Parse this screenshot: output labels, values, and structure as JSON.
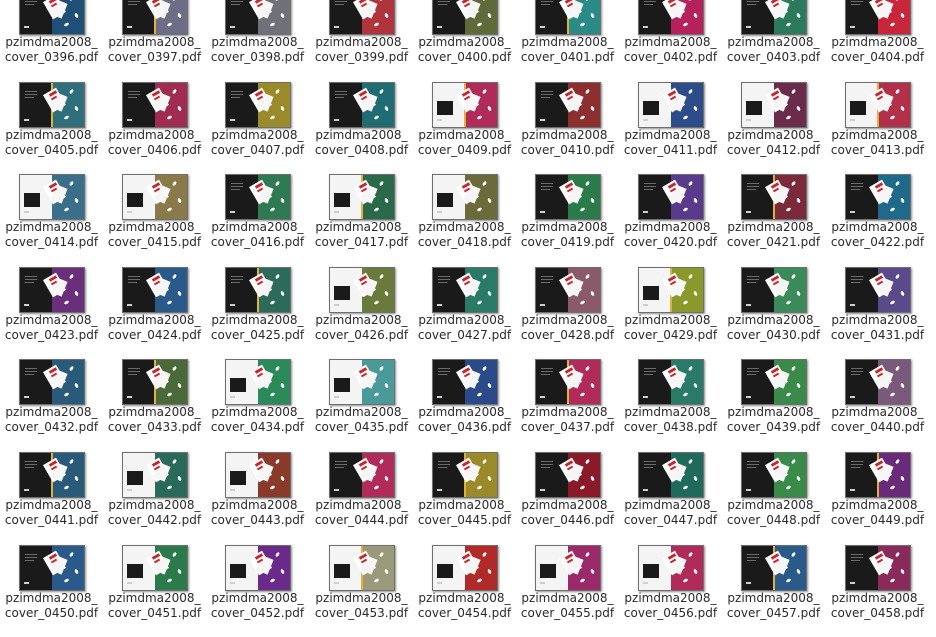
{
  "files": [
    {
      "name": "pzimdma2008_cover_0396.pdf",
      "line1": "pzimdma2008_",
      "line2": "cover_0396.pdf",
      "color": "#1f4f77",
      "variant": "dark"
    },
    {
      "name": "pzimdma2008_cover_0397.pdf",
      "line1": "pzimdma2008_",
      "line2": "cover_0397.pdf",
      "color": "#6b6e86",
      "variant": "dark"
    },
    {
      "name": "pzimdma2008_cover_0398.pdf",
      "line1": "pzimdma2008_",
      "line2": "cover_0398.pdf",
      "color": "#6f7078",
      "variant": "dark"
    },
    {
      "name": "pzimdma2008_cover_0399.pdf",
      "line1": "pzimdma2008_",
      "line2": "cover_0399.pdf",
      "color": "#b0343e",
      "variant": "dark"
    },
    {
      "name": "pzimdma2008_cover_0400.pdf",
      "line1": "pzimdma2008_",
      "line2": "cover_0400.pdf",
      "color": "#5d6a3a",
      "variant": "dark"
    },
    {
      "name": "pzimdma2008_cover_0401.pdf",
      "line1": "pzimdma2008_",
      "line2": "cover_0401.pdf",
      "color": "#2a8b86",
      "variant": "dark"
    },
    {
      "name": "pzimdma2008_cover_0402.pdf",
      "line1": "pzimdma2008_",
      "line2": "cover_0402.pdf",
      "color": "#b5225a",
      "variant": "dark"
    },
    {
      "name": "pzimdma2008_cover_0403.pdf",
      "line1": "pzimdma2008_",
      "line2": "cover_0403.pdf",
      "color": "#2c7a5c",
      "variant": "dark"
    },
    {
      "name": "pzimdma2008_cover_0404.pdf",
      "line1": "pzimdma2008_",
      "line2": "cover_0404.pdf",
      "color": "#c8263b",
      "variant": "dark"
    },
    {
      "name": "pzimdma2008_cover_0405.pdf",
      "line1": "pzimdma2008_",
      "line2": "cover_0405.pdf",
      "color": "#2f6f7b",
      "variant": "dark"
    },
    {
      "name": "pzimdma2008_cover_0406.pdf",
      "line1": "pzimdma2008_",
      "line2": "cover_0406.pdf",
      "color": "#a02c52",
      "variant": "dark"
    },
    {
      "name": "pzimdma2008_cover_0407.pdf",
      "line1": "pzimdma2008_",
      "line2": "cover_0407.pdf",
      "color": "#9b8a2a",
      "variant": "dark"
    },
    {
      "name": "pzimdma2008_cover_0408.pdf",
      "line1": "pzimdma2008_",
      "line2": "cover_0408.pdf",
      "color": "#1f6c72",
      "variant": "dark"
    },
    {
      "name": "pzimdma2008_cover_0409.pdf",
      "line1": "pzimdma2008_",
      "line2": "cover_0409.pdf",
      "color": "#b02a5a",
      "variant": "white"
    },
    {
      "name": "pzimdma2008_cover_0410.pdf",
      "line1": "pzimdma2008_",
      "line2": "cover_0410.pdf",
      "color": "#8e2f2f",
      "variant": "dark"
    },
    {
      "name": "pzimdma2008_cover_0411.pdf",
      "line1": "pzimdma2008_",
      "line2": "cover_0411.pdf",
      "color": "#2c4d8a",
      "variant": "white"
    },
    {
      "name": "pzimdma2008_cover_0412.pdf",
      "line1": "pzimdma2008_",
      "line2": "cover_0412.pdf",
      "color": "#6a2c4a",
      "variant": "white"
    },
    {
      "name": "pzimdma2008_cover_0413.pdf",
      "line1": "pzimdma2008_",
      "line2": "cover_0413.pdf",
      "color": "#b2304a",
      "variant": "white"
    },
    {
      "name": "pzimdma2008_cover_0414.pdf",
      "line1": "pzimdma2008_",
      "line2": "cover_0414.pdf",
      "color": "#3a6f89",
      "variant": "white"
    },
    {
      "name": "pzimdma2008_cover_0415.pdf",
      "line1": "pzimdma2008_",
      "line2": "cover_0415.pdf",
      "color": "#8a7a4a",
      "variant": "white"
    },
    {
      "name": "pzimdma2008_cover_0416.pdf",
      "line1": "pzimdma2008_",
      "line2": "cover_0416.pdf",
      "color": "#2f7a52",
      "variant": "dark"
    },
    {
      "name": "pzimdma2008_cover_0417.pdf",
      "line1": "pzimdma2008_",
      "line2": "cover_0417.pdf",
      "color": "#2a6a4a",
      "variant": "white"
    },
    {
      "name": "pzimdma2008_cover_0418.pdf",
      "line1": "pzimdma2008_",
      "line2": "cover_0418.pdf",
      "color": "#6a6a3a",
      "variant": "white"
    },
    {
      "name": "pzimdma2008_cover_0419.pdf",
      "line1": "pzimdma2008_",
      "line2": "cover_0419.pdf",
      "color": "#2a7a4a",
      "variant": "dark"
    },
    {
      "name": "pzimdma2008_cover_0420.pdf",
      "line1": "pzimdma2008_",
      "line2": "cover_0420.pdf",
      "color": "#5a3a8a",
      "variant": "dark"
    },
    {
      "name": "pzimdma2008_cover_0421.pdf",
      "line1": "pzimdma2008_",
      "line2": "cover_0421.pdf",
      "color": "#7a2a3a",
      "variant": "dark"
    },
    {
      "name": "pzimdma2008_cover_0422.pdf",
      "line1": "pzimdma2008_",
      "line2": "cover_0422.pdf",
      "color": "#1f6a8a",
      "variant": "dark"
    },
    {
      "name": "pzimdma2008_cover_0423.pdf",
      "line1": "pzimdma2008_",
      "line2": "cover_0423.pdf",
      "color": "#6a2f7a",
      "variant": "dark"
    },
    {
      "name": "pzimdma2008_cover_0424.pdf",
      "line1": "pzimdma2008_",
      "line2": "cover_0424.pdf",
      "color": "#2a5a8a",
      "variant": "dark"
    },
    {
      "name": "pzimdma2008_cover_0425.pdf",
      "line1": "pzimdma2008_",
      "line2": "cover_0425.pdf",
      "color": "#2c6a5a",
      "variant": "dark"
    },
    {
      "name": "pzimdma2008_cover_0426.pdf",
      "line1": "pzimdma2008_",
      "line2": "cover_0426.pdf",
      "color": "#6a7a3a",
      "variant": "white"
    },
    {
      "name": "pzimdma2008_cover_0427.pdf",
      "line1": "pzimdma2008_",
      "line2": "cover_0427.pdf",
      "color": "#2a7a6a",
      "variant": "dark"
    },
    {
      "name": "pzimdma2008_cover_0428.pdf",
      "line1": "pzimdma2008_",
      "line2": "cover_0428.pdf",
      "color": "#8a5a6a",
      "variant": "dark"
    },
    {
      "name": "pzimdma2008_cover_0429.pdf",
      "line1": "pzimdma2008_",
      "line2": "cover_0429.pdf",
      "color": "#8a9a2a",
      "variant": "white"
    },
    {
      "name": "pzimdma2008_cover_0430.pdf",
      "line1": "pzimdma2008_",
      "line2": "cover_0430.pdf",
      "color": "#3a8a5a",
      "variant": "dark"
    },
    {
      "name": "pzimdma2008_cover_0431.pdf",
      "line1": "pzimdma2008_",
      "line2": "cover_0431.pdf",
      "color": "#5a4a8a",
      "variant": "dark"
    },
    {
      "name": "pzimdma2008_cover_0432.pdf",
      "line1": "pzimdma2008_",
      "line2": "cover_0432.pdf",
      "color": "#2a5a7a",
      "variant": "dark"
    },
    {
      "name": "pzimdma2008_cover_0433.pdf",
      "line1": "pzimdma2008_",
      "line2": "cover_0433.pdf",
      "color": "#4a6a3a",
      "variant": "dark"
    },
    {
      "name": "pzimdma2008_cover_0434.pdf",
      "line1": "pzimdma2008_",
      "line2": "cover_0434.pdf",
      "color": "#2a8a5a",
      "variant": "white"
    },
    {
      "name": "pzimdma2008_cover_0435.pdf",
      "line1": "pzimdma2008_",
      "line2": "cover_0435.pdf",
      "color": "#4a9a9a",
      "variant": "white"
    },
    {
      "name": "pzimdma2008_cover_0436.pdf",
      "line1": "pzimdma2008_",
      "line2": "cover_0436.pdf",
      "color": "#2a4a8a",
      "variant": "dark"
    },
    {
      "name": "pzimdma2008_cover_0437.pdf",
      "line1": "pzimdma2008_",
      "line2": "cover_0437.pdf",
      "color": "#b02a5a",
      "variant": "dark"
    },
    {
      "name": "pzimdma2008_cover_0438.pdf",
      "line1": "pzimdma2008_",
      "line2": "cover_0438.pdf",
      "color": "#2a7a6a",
      "variant": "dark"
    },
    {
      "name": "pzimdma2008_cover_0439.pdf",
      "line1": "pzimdma2008_",
      "line2": "cover_0439.pdf",
      "color": "#3a8a4a",
      "variant": "dark"
    },
    {
      "name": "pzimdma2008_cover_0440.pdf",
      "line1": "pzimdma2008_",
      "line2": "cover_0440.pdf",
      "color": "#7a5a7a",
      "variant": "dark"
    },
    {
      "name": "pzimdma2008_cover_0441.pdf",
      "line1": "pzimdma2008_",
      "line2": "cover_0441.pdf",
      "color": "#2a5a7a",
      "variant": "dark"
    },
    {
      "name": "pzimdma2008_cover_0442.pdf",
      "line1": "pzimdma2008_",
      "line2": "cover_0442.pdf",
      "color": "#2a6a5a",
      "variant": "white"
    },
    {
      "name": "pzimdma2008_cover_0443.pdf",
      "line1": "pzimdma2008_",
      "line2": "cover_0443.pdf",
      "color": "#8a3a2a",
      "variant": "white"
    },
    {
      "name": "pzimdma2008_cover_0444.pdf",
      "line1": "pzimdma2008_",
      "line2": "cover_0444.pdf",
      "color": "#b02a5a",
      "variant": "dark"
    },
    {
      "name": "pzimdma2008_cover_0445.pdf",
      "line1": "pzimdma2008_",
      "line2": "cover_0445.pdf",
      "color": "#9a8a2a",
      "variant": "dark"
    },
    {
      "name": "pzimdma2008_cover_0446.pdf",
      "line1": "pzimdma2008_",
      "line2": "cover_0446.pdf",
      "color": "#8a1a2a",
      "variant": "dark"
    },
    {
      "name": "pzimdma2008_cover_0447.pdf",
      "line1": "pzimdma2008_",
      "line2": "cover_0447.pdf",
      "color": "#1f6a5a",
      "variant": "dark"
    },
    {
      "name": "pzimdma2008_cover_0448.pdf",
      "line1": "pzimdma2008_",
      "line2": "cover_0448.pdf",
      "color": "#3a8a4a",
      "variant": "dark"
    },
    {
      "name": "pzimdma2008_cover_0449.pdf",
      "line1": "pzimdma2008_",
      "line2": "cover_0449.pdf",
      "color": "#6a2a7a",
      "variant": "dark"
    },
    {
      "name": "pzimdma2008_cover_0450.pdf",
      "line1": "pzimdma2008_",
      "line2": "cover_0450.pdf",
      "color": "#2a5a8a",
      "variant": "dark"
    },
    {
      "name": "pzimdma2008_cover_0451.pdf",
      "line1": "pzimdma2008_",
      "line2": "cover_0451.pdf",
      "color": "#2a7a4a",
      "variant": "white"
    },
    {
      "name": "pzimdma2008_cover_0452.pdf",
      "line1": "pzimdma2008_",
      "line2": "cover_0452.pdf",
      "color": "#6a2a8a",
      "variant": "white"
    },
    {
      "name": "pzimdma2008_cover_0453.pdf",
      "line1": "pzimdma2008_",
      "line2": "cover_0453.pdf",
      "color": "#9a9a7a",
      "variant": "white"
    },
    {
      "name": "pzimdma2008_cover_0454.pdf",
      "line1": "pzimdma2008_",
      "line2": "cover_0454.pdf",
      "color": "#b02a2a",
      "variant": "white"
    },
    {
      "name": "pzimdma2008_cover_0455.pdf",
      "line1": "pzimdma2008_",
      "line2": "cover_0455.pdf",
      "color": "#9a2a6a",
      "variant": "white"
    },
    {
      "name": "pzimdma2008_cover_0456.pdf",
      "line1": "pzimdma2008_",
      "line2": "cover_0456.pdf",
      "color": "#b02a5a",
      "variant": "white"
    },
    {
      "name": "pzimdma2008_cover_0457.pdf",
      "line1": "pzimdma2008_",
      "line2": "cover_0457.pdf",
      "color": "#2a5a8a",
      "variant": "dark"
    },
    {
      "name": "pzimdma2008_cover_0458.pdf",
      "line1": "pzimdma2008_",
      "line2": "cover_0458.pdf",
      "color": "#8a2a5a",
      "variant": "dark"
    }
  ]
}
